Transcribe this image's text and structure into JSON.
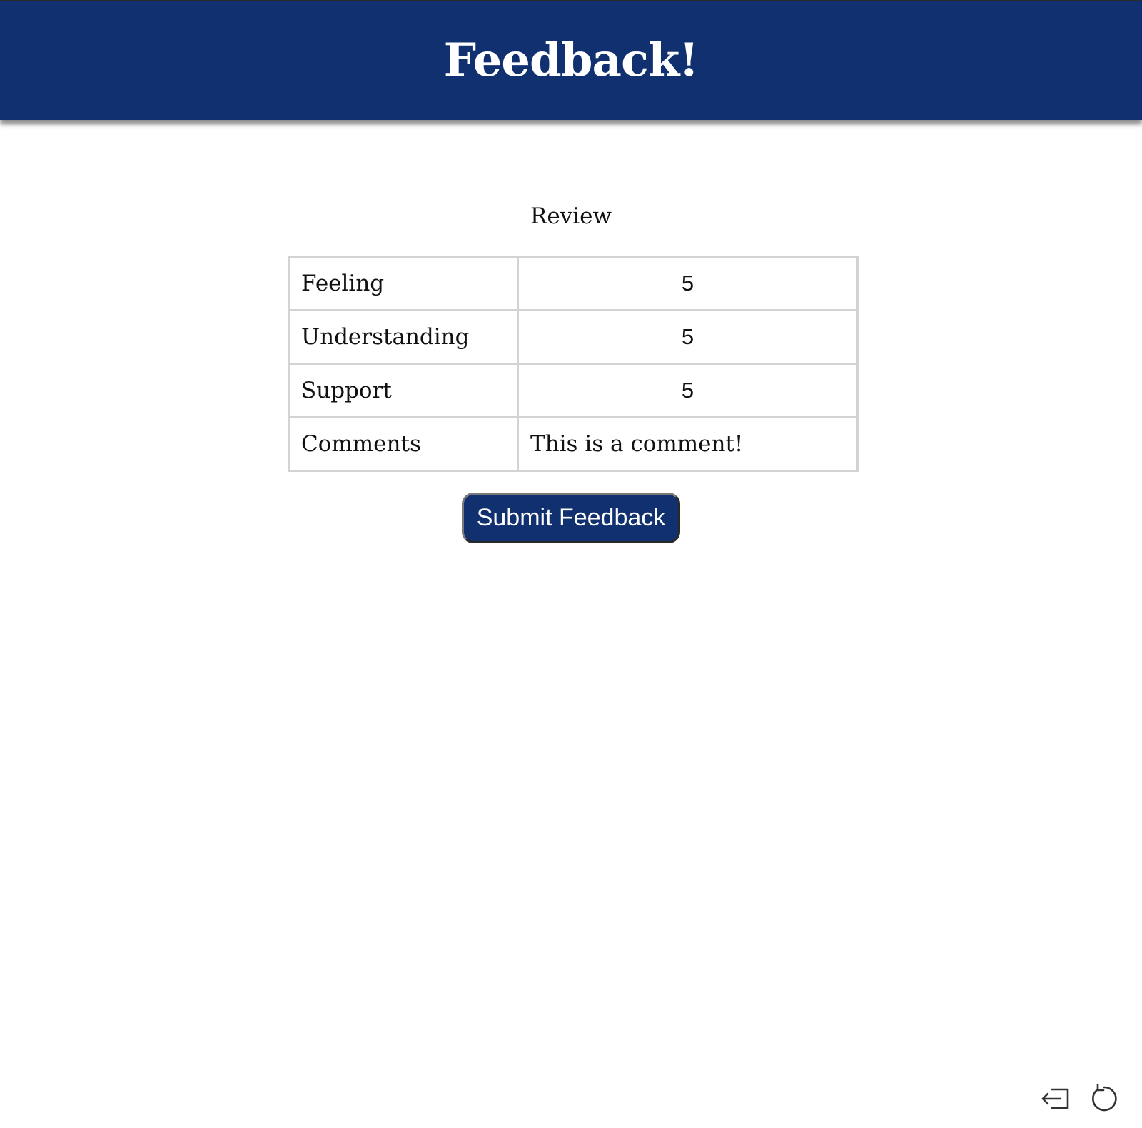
{
  "header": {
    "title": "Feedback!",
    "background_color": "#10306f"
  },
  "review": {
    "heading": "Review",
    "rows": [
      {
        "label": "Feeling",
        "value": "5"
      },
      {
        "label": "Understanding",
        "value": "5"
      },
      {
        "label": "Support",
        "value": "5"
      },
      {
        "label": "Comments",
        "value": "This is a comment!"
      }
    ]
  },
  "actions": {
    "submit_label": "Submit Feedback"
  },
  "corner_controls": {
    "icons": [
      "exit-icon",
      "refresh-icon"
    ]
  }
}
